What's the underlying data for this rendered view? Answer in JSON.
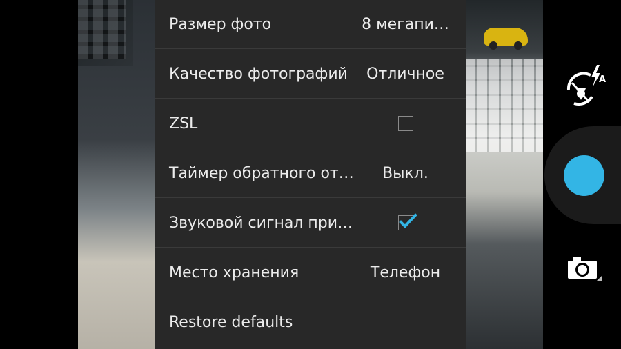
{
  "menu": {
    "items": [
      {
        "label": "Размер фото",
        "value": "8 мегапи…",
        "kind": "value"
      },
      {
        "label": "Качество фотографий",
        "value": "Отличное",
        "kind": "value"
      },
      {
        "label": "ZSL",
        "checked": false,
        "kind": "checkbox"
      },
      {
        "label": "Таймер обратного от…",
        "value": "Выкл.",
        "kind": "value"
      },
      {
        "label": "Звуковой сигнал при…",
        "checked": true,
        "kind": "checkbox"
      },
      {
        "label": "Место хранения",
        "value": "Телефон",
        "kind": "value"
      },
      {
        "label": "Restore defaults",
        "kind": "action"
      }
    ]
  },
  "controls": {
    "flash_icon": "flash-auto-icon",
    "flash_mode_letter": "A",
    "shutter_icon": "shutter-button",
    "switcher_icon": "camera-icon"
  },
  "colors": {
    "accent": "#33b5e5",
    "menu_bg": "#282828",
    "divider": "#3a3a3a",
    "text": "#ececec"
  }
}
